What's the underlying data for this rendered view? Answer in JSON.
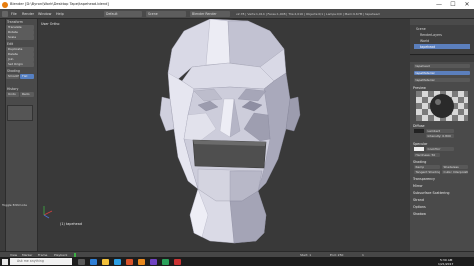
{
  "window": {
    "title": "Blender [D:\\Byron\\Work\\Desktop Tape\\tapehead.blend]",
    "minimize_glyph": "—",
    "maximize_glyph": "☐",
    "close_glyph": "✕"
  },
  "header": {
    "menus": [
      "File",
      "Render",
      "Window",
      "Help"
    ],
    "layout": "Default",
    "scene": "Scene",
    "engine": "Blender Render",
    "stats": "v2.78 | Verts:1,014 | Faces:1,008 | Tris:2,016 | Objects:0/1 | Lamps:0/0 | Mem:9.67M | tapehead"
  },
  "tool_shelf": {
    "sections": [
      {
        "title": "Transform",
        "items": [
          "Translate",
          "Rotate",
          "Scale"
        ]
      },
      {
        "title": "Edit",
        "items": [
          "Duplicate",
          "Delete",
          "Join",
          "Set Origin"
        ]
      },
      {
        "title": "Shading",
        "items": [
          "Smooth",
          "Flat"
        ]
      },
      {
        "title": "History",
        "items": [
          "Undo",
          "Redo"
        ]
      }
    ],
    "toggle_label": "Toggle Editmode"
  },
  "viewport": {
    "label": "User Ortho",
    "object_label": "(1) tapehead",
    "colors": {
      "background": "#393939",
      "face_light": "#e4e4ee",
      "face_mid": "#bfbfcf",
      "face_dark": "#8c8c9c",
      "tape": "#555555"
    }
  },
  "outliner": {
    "items": [
      "Scene",
      "RenderLayers",
      "World",
      "tapehead"
    ]
  },
  "properties": {
    "object_name": "tapehead",
    "material_name": "tapeMaterial",
    "panels": [
      "Preview",
      "Diffuse",
      "Specular",
      "Shading",
      "Transparency",
      "Mirror",
      "Subsurface Scattering",
      "Strand",
      "Options",
      "Shadow"
    ],
    "diffuse_shader": "Lambert",
    "intensity_label": "Intensity: 0.800",
    "specular_shader": "CookTorr",
    "hardness_label": "Hardness: 50",
    "checkboxes": [
      "Ramp",
      "Shadeless",
      "Tangent Shading",
      "Cubic Interpolation"
    ]
  },
  "timeline": {
    "menus": [
      "View",
      "Marker",
      "Frame",
      "Playback"
    ],
    "start_label": "Start: 1",
    "end_label": "End: 250",
    "current_frame": "1"
  },
  "taskbar": {
    "search_placeholder": "Ask me anything",
    "time": "5:30 AM",
    "date": "1/21/2017"
  }
}
